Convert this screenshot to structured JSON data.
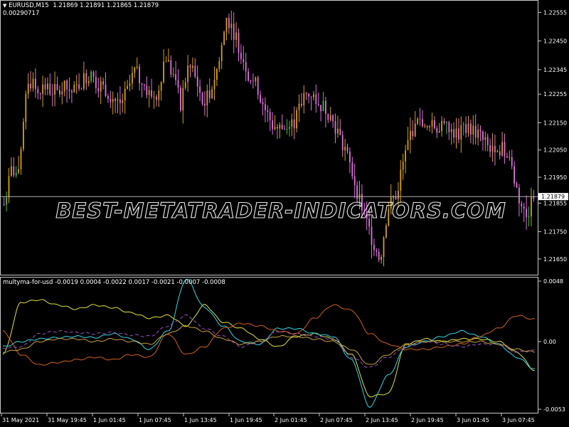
{
  "header": {
    "symbol": "EURUSD,M15",
    "ohlc": "1.21869 1.21891 1.21865 1.21879",
    "value_line": "0.00290717",
    "menu_icon": "triangle-down-icon"
  },
  "price_axis": {
    "ticks": [
      "1.22555",
      "1.22450",
      "1.22345",
      "1.22255",
      "1.22150",
      "1.22050",
      "1.21950",
      "1.21855",
      "1.21750",
      "1.21650"
    ],
    "current_price": "1.21879"
  },
  "indicator": {
    "label": "multyma-for-usd -0.0019 0.0004 -0.0022 0.0017 -0.0021 -0.0007 -0.0008",
    "ticks": [
      "0.0048",
      "0.00",
      "-0.0053"
    ]
  },
  "time_axis": {
    "labels": [
      "31 May 2021",
      "31 May 19:45",
      "1 Jun 01:45",
      "1 Jun 07:45",
      "1 Jun 13:45",
      "1 Jun 19:45",
      "2 Jun 01:45",
      "2 Jun 07:45",
      "2 Jun 13:45",
      "2 Jun 19:45",
      "3 Jun 01:45",
      "3 Jun 07:45"
    ]
  },
  "watermark": "BEST-METATRADER-INDICATORS.COM",
  "colors": {
    "bull": "#d4a017",
    "bear": "#e070e0",
    "bull_alt": "#40c040",
    "line_yellow": "#e0e040",
    "line_cyan": "#30d8e8",
    "line_orange": "#d06020",
    "line_purple_dash": "#a050c0",
    "line_gold": "#c8a040",
    "current_price_line": "#b0b0b0"
  },
  "chart_data": [
    {
      "type": "candlestick",
      "title": "EURUSD,M15",
      "ylim": [
        1.216,
        1.2259
      ],
      "close_path": [
        1.2185,
        1.2198,
        1.2195,
        1.2232,
        1.2228,
        1.2228,
        1.2227,
        1.2226,
        1.2228,
        1.2226,
        1.223,
        1.2233,
        1.223,
        1.2228,
        1.2225,
        1.2222,
        1.2226,
        1.2234,
        1.223,
        1.2225,
        1.2226,
        1.224,
        1.2232,
        1.2222,
        1.2236,
        1.2231,
        1.2221,
        1.2228,
        1.2237,
        1.2254,
        1.2248,
        1.224,
        1.2232,
        1.2228,
        1.222,
        1.2214,
        1.2213,
        1.2213,
        1.2216,
        1.2224,
        1.2226,
        1.2222,
        1.222,
        1.2215,
        1.2208,
        1.22,
        1.219,
        1.218,
        1.2172,
        1.2165,
        1.2184,
        1.2188,
        1.22,
        1.2212,
        1.2215,
        1.2212,
        1.2214,
        1.2213,
        1.2212,
        1.2211,
        1.2212,
        1.2213,
        1.221,
        1.2206,
        1.2207,
        1.2205,
        1.22,
        1.2188,
        1.218,
        1.2188
      ]
    },
    {
      "type": "line",
      "title": "multyma-for-usd",
      "ylim": [
        -0.0053,
        0.0048
      ],
      "series": [
        {
          "color": "#e0e040",
          "values": [
            -0.001,
            0.003,
            0.0032,
            0.0028,
            0.0025,
            0.0028,
            0.0026,
            0.0022,
            0.0018,
            0.002,
            0.0012,
            0.0028,
            0.0015,
            0.001,
            0.0002,
            -0.0004,
            0.0004,
            0.0006,
            0.0002,
            -0.001,
            -0.0042,
            -0.004,
            -0.0002,
            0.0002,
            0.0,
            0.0002,
            0.0002,
            0.0,
            -0.0008,
            -0.0022
          ]
        },
        {
          "color": "#30d8e8",
          "values": [
            -0.0004,
            0.0,
            0.0002,
            0.0003,
            0.0004,
            0.0003,
            0.0006,
            0.0002,
            -0.0006,
            0.0008,
            0.0048,
            0.0026,
            0.0012,
            0.0,
            -0.0002,
            0.001,
            0.001,
            0.0006,
            0.0004,
            -0.0014,
            -0.005,
            -0.0026,
            -0.0004,
            0.0,
            0.0004,
            0.0008,
            0.0004,
            -0.0002,
            -0.0012,
            -0.0021
          ]
        },
        {
          "color": "#d06020",
          "values": [
            0.0008,
            -0.001,
            -0.0018,
            -0.0016,
            -0.0014,
            -0.0012,
            -0.0014,
            -0.001,
            -0.0012,
            0.0006,
            -0.001,
            -0.0004,
            0.001,
            0.0014,
            0.0012,
            0.0008,
            0.0006,
            0.0018,
            0.0028,
            0.0024,
            0.0006,
            -0.0002,
            -0.0006,
            -0.0006,
            -0.0004,
            -0.0002,
            0.0004,
            0.001,
            0.002,
            0.0017
          ]
        },
        {
          "color": "#a050c0",
          "dashed": true,
          "values": [
            -0.0005,
            -0.0004,
            0.0006,
            0.0008,
            0.0007,
            0.0006,
            0.0007,
            0.0005,
            0.0004,
            0.0012,
            0.002,
            0.001,
            0.0004,
            -0.0004,
            0.0,
            0.0008,
            0.0006,
            0.0004,
            0.0002,
            -0.0012,
            -0.002,
            -0.0012,
            -0.0004,
            0.0,
            -0.0002,
            -0.0004,
            -0.0002,
            -0.0002,
            -0.0008,
            -0.0007
          ]
        },
        {
          "color": "#c8a040",
          "values": [
            -0.0008,
            -0.0006,
            0.0,
            0.0002,
            0.0002,
            0.0,
            0.0002,
            0.0,
            -0.0002,
            0.0006,
            0.0012,
            0.0008,
            0.0002,
            -0.0002,
            0.0,
            0.0004,
            0.0004,
            0.0002,
            0.0,
            -0.0006,
            -0.0018,
            -0.001,
            -0.0002,
            0.0,
            0.0,
            0.0,
            0.0,
            -0.0002,
            -0.0006,
            -0.0008
          ]
        }
      ]
    }
  ]
}
